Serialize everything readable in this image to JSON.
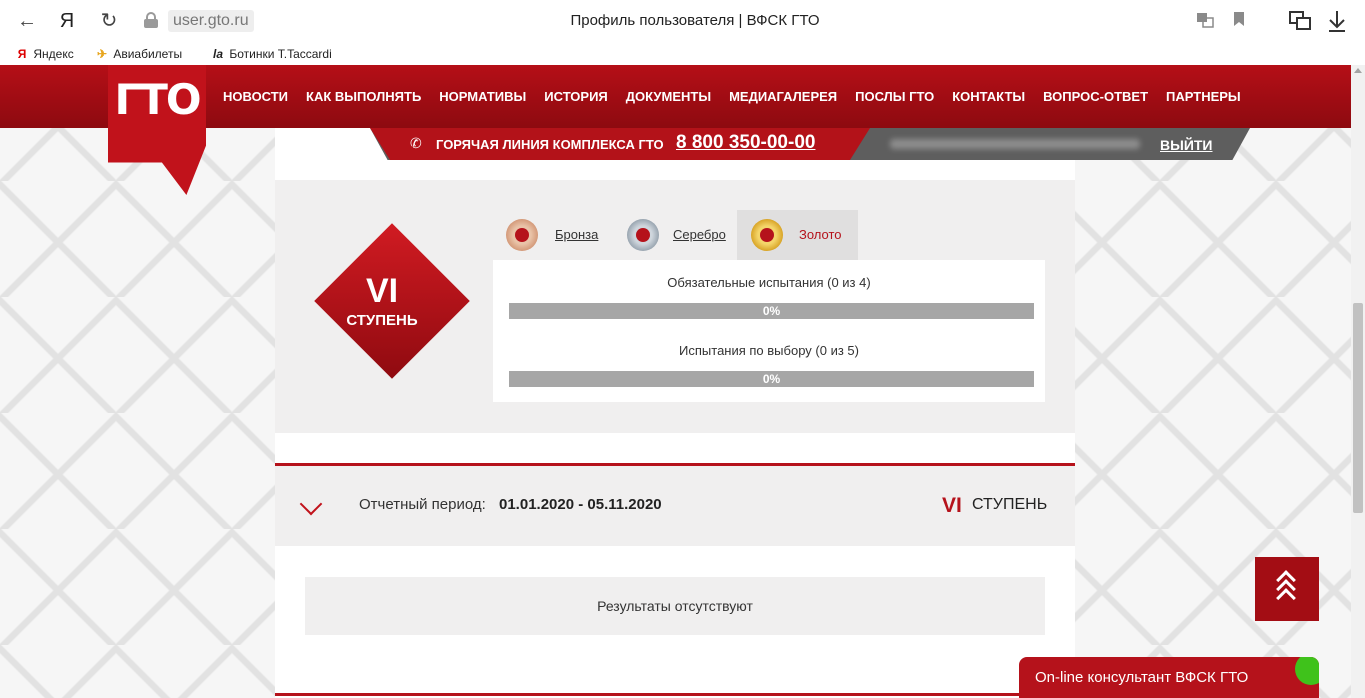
{
  "browser": {
    "url": "user.gto.ru",
    "title": "Профиль пользователя | ВФСК ГТО",
    "back_icon": "←",
    "yandex_icon": "Я",
    "reload_icon": "↻",
    "bookmarks": [
      {
        "icon": "Я",
        "label": "Яндекс"
      },
      {
        "icon": "✈",
        "label": "Авиабилеты"
      },
      {
        "icon": "la",
        "label": "Ботинки T.Taccardi"
      }
    ]
  },
  "header": {
    "logo": "ГТО",
    "menu": [
      "НОВОСТИ",
      "КАК ВЫПОЛНЯТЬ",
      "НОРМАТИВЫ",
      "ИСТОРИЯ",
      "ДОКУМЕНТЫ",
      "МЕДИАГАЛЕРЕЯ",
      "ПОСЛЫ ГТО",
      "КОНТАКТЫ",
      "ВОПРОС-ОТВЕТ",
      "ПАРТНЕРЫ"
    ],
    "hotline_label": "ГОРЯЧАЯ ЛИНИЯ КОМПЛЕКСА ГТО",
    "hotline_number": "8 800 350-00-00",
    "logout": "ВЫЙТИ"
  },
  "level": {
    "roman": "VI",
    "label": "СТУПЕНЬ",
    "badges": [
      {
        "label": "Бронза",
        "icon": "bronze-medal-icon",
        "active": false
      },
      {
        "label": "Серебро",
        "icon": "silver-medal-icon",
        "active": false
      },
      {
        "label": "Золото",
        "icon": "gold-medal-icon",
        "active": true
      }
    ],
    "tests": [
      {
        "label": "Обязательные испытания (0 из 4)",
        "percent_text": "0%",
        "progress": 0
      },
      {
        "label": "Испытания по выбору (0 из 5)",
        "percent_text": "0%",
        "progress": 0
      }
    ]
  },
  "period": {
    "label": "Отчетный период:",
    "value": "01.01.2020 - 05.11.2020",
    "roman": "VI",
    "step": "СТУПЕНЬ"
  },
  "results": {
    "empty_text": "Результаты отсутствуют"
  },
  "consultant": {
    "label": "On-line консультант ВФСК ГТО"
  },
  "colors": {
    "brand_red": "#b5121b",
    "panel_gray": "#f0efef",
    "progress_gray": "#a6a6a6",
    "online_green": "#3fc21b"
  }
}
